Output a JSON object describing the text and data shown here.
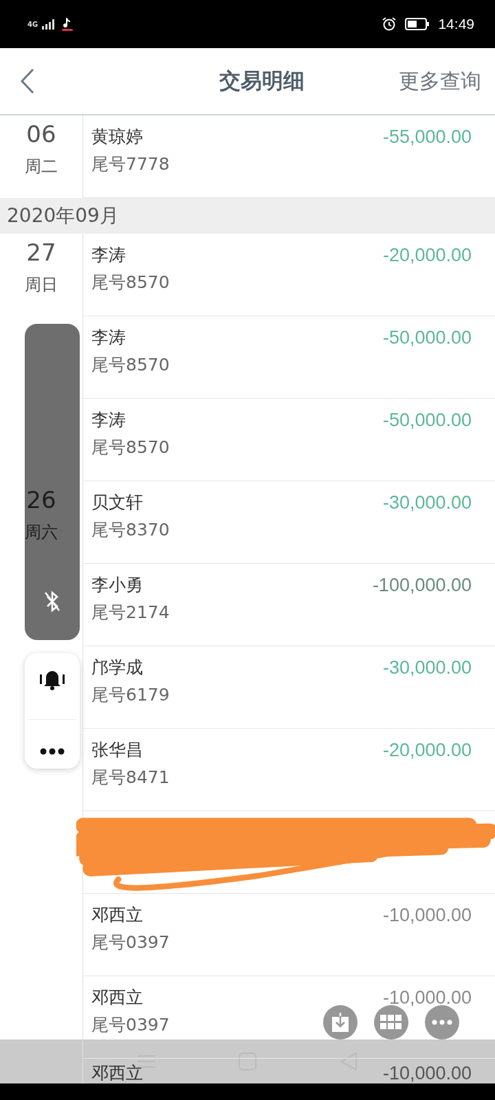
{
  "status_bar": {
    "network": "4G",
    "time": "14:49"
  },
  "header": {
    "title": "交易明细",
    "action": "更多查询"
  },
  "sections": [
    {
      "kind": "day",
      "day": "06",
      "weekday": "周二",
      "rows": [
        {
          "kind": "entry",
          "name": "黄琼婷",
          "tail": "尾号7778",
          "amount": "-55,000.00",
          "color": "#5cb896"
        }
      ]
    },
    {
      "kind": "month",
      "label": "2020年09月"
    },
    {
      "kind": "day",
      "day": "27",
      "weekday": "周日",
      "rows": [
        {
          "kind": "entry",
          "name": "李涛",
          "tail": "尾号8570",
          "amount": "-20,000.00",
          "color": "#5cb896"
        },
        {
          "kind": "entry",
          "name": "李涛",
          "tail": "尾号8570",
          "amount": "-50,000.00",
          "color": "#5cb896"
        },
        {
          "kind": "entry",
          "name": "李涛",
          "tail": "尾号8570",
          "amount": "-50,000.00",
          "color": "#5cb896"
        }
      ]
    },
    {
      "kind": "day",
      "day": "26",
      "weekday": "周六",
      "rows": [
        {
          "kind": "entry",
          "name": "贝文轩",
          "tail": "尾号8370",
          "amount": "-30,000.00",
          "color": "#5cb896"
        },
        {
          "kind": "entry",
          "name": "李小勇",
          "tail": "尾号2174",
          "amount": "-100,000.00",
          "color": "#6b8a80"
        }
      ]
    },
    {
      "kind": "day",
      "rows": [
        {
          "kind": "entry",
          "name": "邝学成",
          "tail": "尾号6179",
          "amount": "-30,000.00",
          "color": "#5cb896"
        },
        {
          "kind": "entry",
          "name": "张华昌",
          "tail": "尾号8471",
          "amount": "-20,000.00",
          "color": "#5cb896"
        },
        {
          "kind": "redacted"
        },
        {
          "kind": "entry",
          "name": "邓西立",
          "tail": "尾号0397",
          "amount": "-10,000.00",
          "color": "#8a8a8a"
        },
        {
          "kind": "entry",
          "name": "邓西立",
          "tail": "尾号0397",
          "amount": "-10,000.00",
          "color": "#8a8a8a"
        },
        {
          "kind": "entry",
          "name": "邓西立",
          "amount": "-10,000.00",
          "color": "#555555"
        }
      ]
    }
  ]
}
